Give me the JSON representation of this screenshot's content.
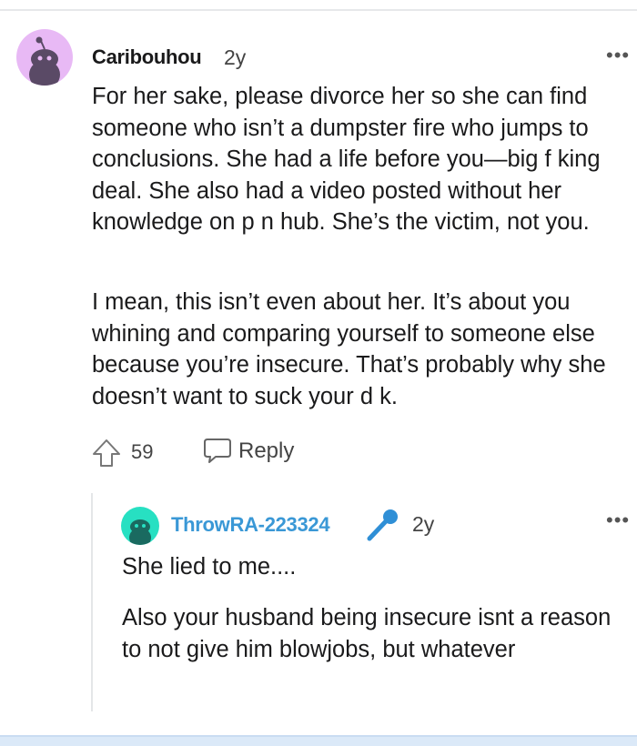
{
  "comment": {
    "author": "Caribouhou",
    "age": "2y",
    "more": "•••",
    "paragraphs": [
      "For her sake, please divorce her so she can find someone who isn’t a dumpster fire who jumps to conclusions. She had a life before you—big f   king deal. She also had a video posted without her knowledge on p   n hub. She’s the victim, not you.",
      "I mean, this isn’t even about her. It’s about you whining and comparing yourself to someone else because you’re insecure. That’s probably why she doesn’t want to suck your d   k."
    ],
    "votes": "59",
    "reply_label": "Reply",
    "colors": {
      "avatar_bg": "#e8b9f5",
      "avatar_fg": "#5a4a66"
    }
  },
  "reply": {
    "author": "ThrowRA-223324",
    "badge_icon": "microphone-icon",
    "age": "2y",
    "more": "•••",
    "paragraphs": [
      "She lied to me....",
      "Also your husband being insecure isnt a reason to not give him blowjobs, but whatever"
    ],
    "colors": {
      "author": "#3a98d6",
      "avatar_bg": "#27e0c2",
      "avatar_fg": "#1a6a60",
      "badge": "#2f8fd6"
    }
  }
}
